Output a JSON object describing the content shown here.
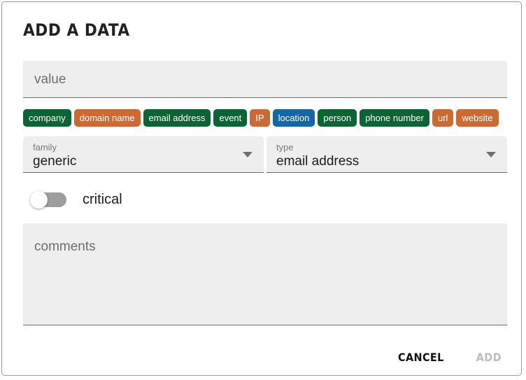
{
  "dialog": {
    "title": "ADD A DATA"
  },
  "value_field": {
    "placeholder": "value",
    "value": ""
  },
  "chips": [
    {
      "label": "company",
      "color": "#0b6434"
    },
    {
      "label": "domain name",
      "color": "#cd6a34"
    },
    {
      "label": "email address",
      "color": "#0b6434"
    },
    {
      "label": "event",
      "color": "#0b6434"
    },
    {
      "label": "IP",
      "color": "#cd6a34"
    },
    {
      "label": "location",
      "color": "#1167a8"
    },
    {
      "label": "person",
      "color": "#0b6434"
    },
    {
      "label": "phone number",
      "color": "#0b6434"
    },
    {
      "label": "url",
      "color": "#cd6a34"
    },
    {
      "label": "website",
      "color": "#cd6a34"
    }
  ],
  "family_select": {
    "label": "family",
    "value": "generic"
  },
  "type_select": {
    "label": "type",
    "value": "email address"
  },
  "critical_toggle": {
    "label": "critical",
    "state": "off"
  },
  "comments_field": {
    "placeholder": "comments",
    "value": ""
  },
  "footer": {
    "cancel_label": "CANCEL",
    "add_label": "ADD"
  }
}
